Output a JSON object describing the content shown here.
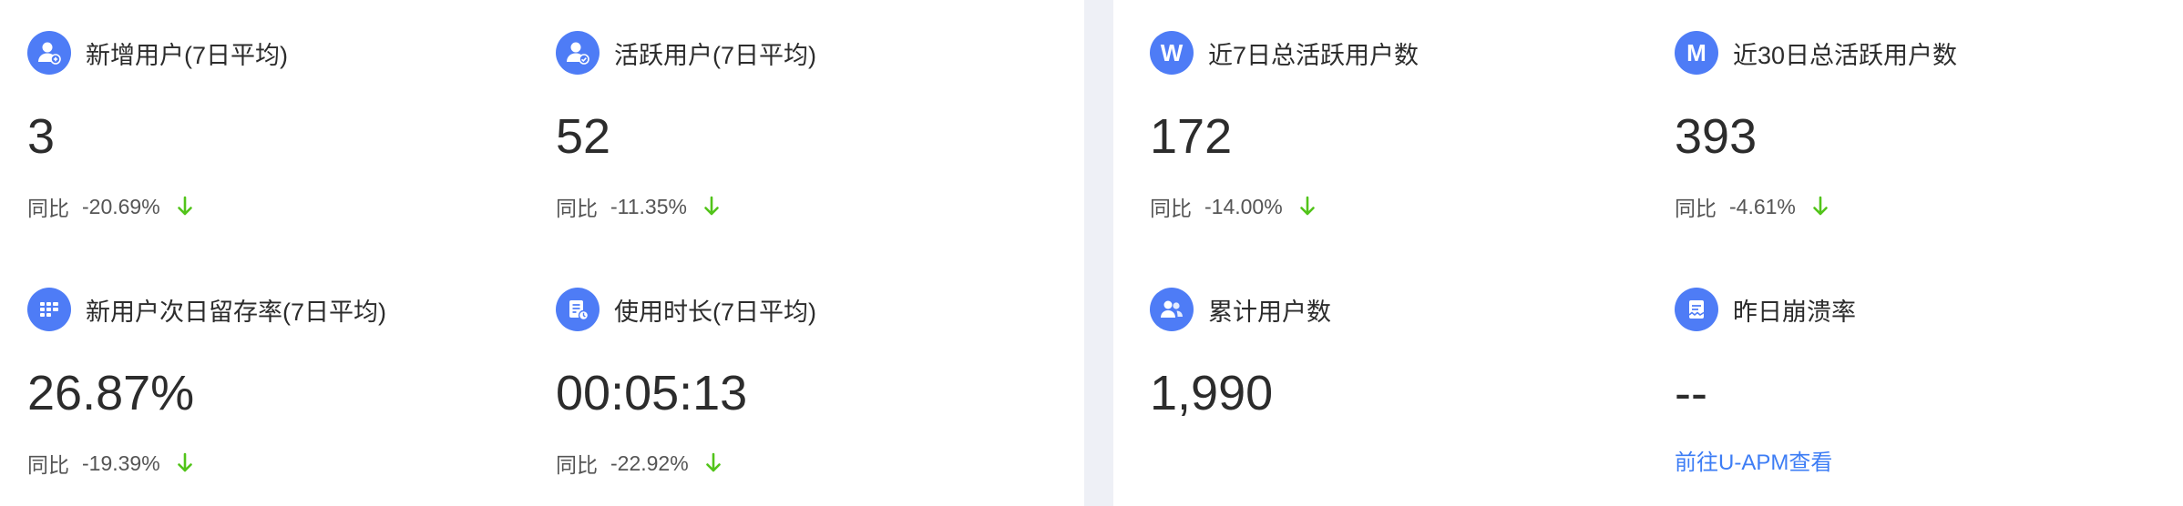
{
  "colors": {
    "accent": "#4e7cf6",
    "down_arrow": "#52c41a",
    "link": "#3d7df5",
    "divider": "#eef0f6"
  },
  "cards": {
    "new_users": {
      "icon": "user-plus-icon",
      "title": "新增用户(7日平均)",
      "value": "3",
      "compare_label": "同比",
      "compare_pct": "-20.69%",
      "trend": "down"
    },
    "active_users": {
      "icon": "user-active-icon",
      "title": "活跃用户(7日平均)",
      "value": "52",
      "compare_label": "同比",
      "compare_pct": "-11.35%",
      "trend": "down"
    },
    "retention": {
      "icon": "grid-icon",
      "title": "新用户次日留存率(7日平均)",
      "value": "26.87%",
      "compare_label": "同比",
      "compare_pct": "-19.39%",
      "trend": "down"
    },
    "duration": {
      "icon": "document-clock-icon",
      "title": "使用时长(7日平均)",
      "value": "00:05:13",
      "compare_label": "同比",
      "compare_pct": "-22.92%",
      "trend": "down"
    },
    "weekly_active": {
      "icon": "w-letter-icon",
      "icon_text": "W",
      "title": "近7日总活跃用户数",
      "value": "172",
      "compare_label": "同比",
      "compare_pct": "-14.00%",
      "trend": "down"
    },
    "monthly_active": {
      "icon": "m-letter-icon",
      "icon_text": "M",
      "title": "近30日总活跃用户数",
      "value": "393",
      "compare_label": "同比",
      "compare_pct": "-4.61%",
      "trend": "down"
    },
    "total_users": {
      "icon": "users-icon",
      "title": "累计用户数",
      "value": "1,990"
    },
    "crash_rate": {
      "icon": "crash-report-icon",
      "title": "昨日崩溃率",
      "value": "--",
      "link": "前往U-APM查看"
    }
  }
}
